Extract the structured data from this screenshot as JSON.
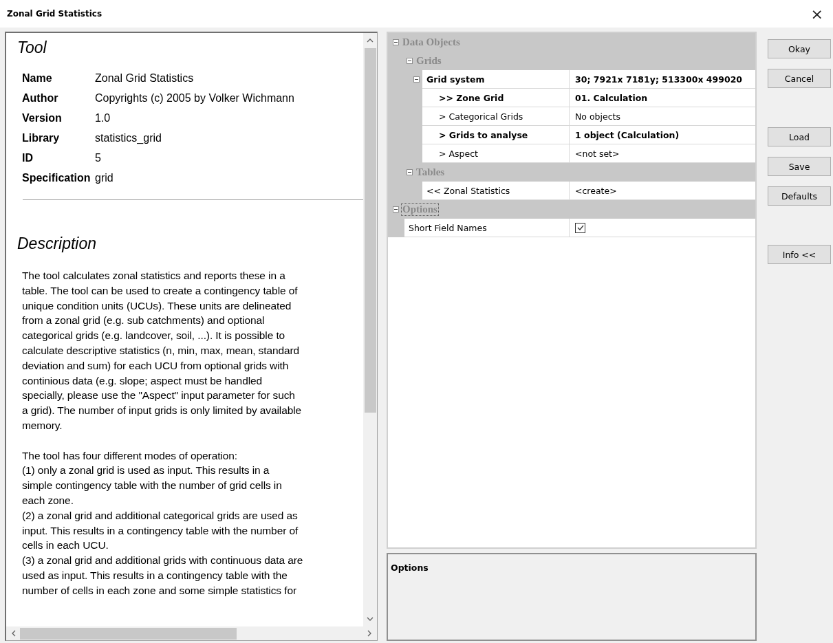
{
  "window": {
    "title": "Zonal Grid Statistics",
    "close": "×"
  },
  "info": {
    "heading": "Tool",
    "fields": [
      {
        "label": "Name",
        "value": "Zonal Grid Statistics"
      },
      {
        "label": "Author",
        "value": "Copyrights (c) 2005 by Volker Wichmann"
      },
      {
        "label": "Version",
        "value": "1.0"
      },
      {
        "label": "Library",
        "value": "statistics_grid"
      },
      {
        "label": "ID",
        "value": "5"
      },
      {
        "label": "Specification",
        "value": "grid"
      }
    ],
    "description_heading": "Description",
    "paragraphs": [
      "The tool calculates zonal statistics and reports these in a\ntable. The tool can be used to create a contingency table of\nunique condition units (UCUs). These units are delineated\nfrom a zonal grid (e.g. sub catchments) and optional\ncategorical grids (e.g. landcover, soil, ...). It is possible to\ncalculate descriptive statistics (n, min, max, mean, standard\ndeviation and sum) for each UCU from optional grids with\ncontinious data (e.g. slope; aspect must be handled\nspecially, please use the \"Aspect\" input parameter for such\na grid). The number of input grids is only limited by available\nmemory.",
      "The tool has four different modes of operation:\n(1) only a zonal grid is used as input. This results in a\nsimple contingency table with the number of grid cells in\neach zone.\n(2) a zonal grid and additional categorical grids are used as\ninput. This results in a contingency table with the number of\ncells in each UCU.\n(3) a zonal grid and additional grids with continuous data are\nused as input. This results in a contingency table with the\nnumber of cells in each zone and some simple statistics for"
    ]
  },
  "properties": [
    {
      "kind": "group",
      "label": "Data Objects",
      "expanded": true,
      "focused": false,
      "children": [
        {
          "kind": "group",
          "label": "Grids",
          "expanded": true,
          "focused": false,
          "children": [
            {
              "kind": "row",
              "label": "Grid system",
              "value": "30; 7921x 7181y; 513300x 499020",
              "bold": true,
              "expanded": true,
              "children": [
                {
                  "kind": "row",
                  "label": ">> Zone Grid",
                  "value": "01. Calculation",
                  "bold": true
                },
                {
                  "kind": "row",
                  "label": "> Categorical Grids",
                  "value": "No objects",
                  "bold": false
                },
                {
                  "kind": "row",
                  "label": "> Grids to analyse",
                  "value": "1 object (Calculation)",
                  "bold": true
                },
                {
                  "kind": "row",
                  "label": "> Aspect",
                  "value": "<not set>",
                  "bold": false
                }
              ]
            }
          ]
        },
        {
          "kind": "group",
          "label": "Tables",
          "expanded": true,
          "focused": false,
          "children": [
            {
              "kind": "row",
              "label": "<< Zonal Statistics",
              "value": "<create>",
              "bold": false
            }
          ]
        }
      ]
    },
    {
      "kind": "group",
      "label": "Options",
      "expanded": true,
      "focused": true,
      "children": [
        {
          "kind": "checkbox",
          "label": "Short Field Names",
          "checked": true
        }
      ]
    }
  ],
  "options_panel": {
    "title": "Options"
  },
  "button_groups": [
    [
      "Okay",
      "Cancel"
    ],
    [
      "Load",
      "Save",
      "Defaults"
    ],
    [
      "Info <<"
    ]
  ]
}
